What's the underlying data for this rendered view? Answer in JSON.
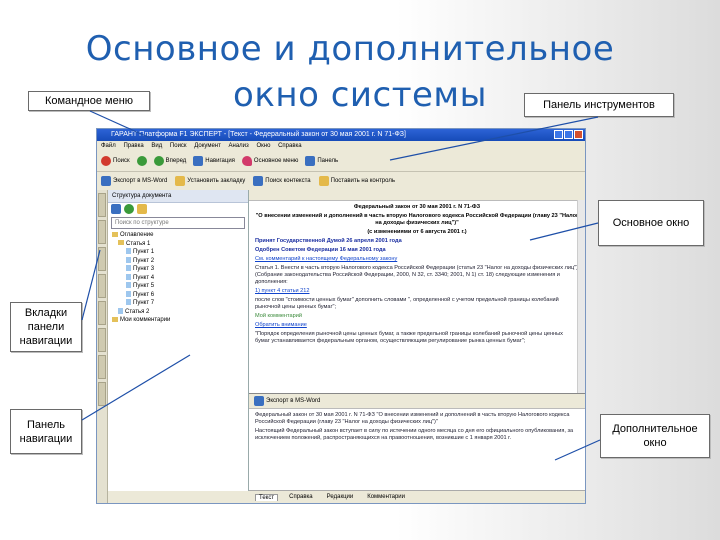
{
  "slide": {
    "title_line1": "Основное и дополнительное",
    "title_line2": "окно системы"
  },
  "callouts": {
    "command_menu": "Командное меню",
    "toolbar_panel": "Панель инструментов",
    "main_window": "Основное окно",
    "nav_tabs": "Вкладки панели навигации",
    "nav_panel": "Панель навигации",
    "additional_window": "Дополнительное окно"
  },
  "app": {
    "window_title": "ГАРАНТ Платформа F1 ЭКСПЕРТ - [Текст - Федеральный закон от 30 мая 2001 г. N 71-ФЗ]",
    "menu": [
      "Файл",
      "Правка",
      "Вид",
      "Поиск",
      "Документ",
      "Анализ",
      "Окно",
      "Справка"
    ],
    "toolbar": {
      "search_btn": "Поиск",
      "forward_btn": "Вперед",
      "nav_btn": "Навигация",
      "cases_btn": "Основное меню",
      "panel_btn": "Панель"
    },
    "toolbar2": {
      "export_btn": "Экспорт в MS-Word",
      "bookmark_btn": "Установить закладку",
      "search_ctx_btn": "Поиск контекста",
      "control_btn": "Поставить на контроль"
    },
    "nav_header": "Структура документа",
    "nav_search": "Поиск по структуре",
    "tree": [
      {
        "label": "Оглавление",
        "kind": "folder",
        "indent": 0
      },
      {
        "label": "Статья 1",
        "kind": "folder",
        "indent": 1
      },
      {
        "label": "Пункт 1",
        "kind": "doc",
        "indent": 2
      },
      {
        "label": "Пункт 2",
        "kind": "doc",
        "indent": 2
      },
      {
        "label": "Пункт 3",
        "kind": "doc",
        "indent": 2
      },
      {
        "label": "Пункт 4",
        "kind": "doc",
        "indent": 2
      },
      {
        "label": "Пункт 5",
        "kind": "doc",
        "indent": 2
      },
      {
        "label": "Пункт 6",
        "kind": "doc",
        "indent": 2
      },
      {
        "label": "Пункт 7",
        "kind": "doc",
        "indent": 2
      },
      {
        "label": "Статья 2",
        "kind": "doc",
        "indent": 1
      },
      {
        "label": "Мои комментарии",
        "kind": "folder",
        "indent": 0
      }
    ],
    "document": {
      "heading": "Федеральный закон от 30 мая 2001 г. N 71-ФЗ",
      "heading2": "\"О внесении изменений и дополнений в часть вторую Налогового кодекса Российской Федерации (главу 23 \"Налог на доходы физических лиц\")\"",
      "changes": "(с изменениями от 6 августа 2001 г.)",
      "accepted": "Принят Государственной Думой 26 апреля 2001 года",
      "approved": "Одобрен Советом Федерации 16 мая 2001 года",
      "comment": "См. комментарий к настоящему Федеральному закону",
      "article": "Статья 1. Внести в часть вторую Налогового кодекса Российской Федерации (статья 23 \"Налог на доходы физических лиц\") (Собрание законодательства Российской Федерации, 2000, N 32, ст. 3340; 2001, N 1) ст. 18) следующие изменения и дополнения:",
      "point1": "1) пункт 4 статьи 212",
      "point1_text": "после слов \"стоимости ценных бумаг\" дополнить словами \", определенной с учетом предельной границы колебаний рыночной цены ценных бумаг\";",
      "mycomment": "Мой комментарий",
      "prev": "Обратить внимание",
      "para": "\"Порядок определения рыночной цены ценных бумаг, а также предельной границы колебаний рыночной цены ценных бумаг устанавливается федеральным органом, осуществляющим регулирование рынка ценных бумаг\";"
    },
    "addwin": {
      "export_btn": "Экспорт в MS-Word",
      "text1": "Федеральный закон от 30 мая 2001 г. N 71-ФЗ \"О внесении изменений и дополнений в часть вторую Налогового кодекса Российской Федерации (главу 23 \"Налог на доходы физических лиц\")\"",
      "text2": "Настоящий Федеральный закон вступает в силу по истечении одного месяца со дня его официального опубликования, за исключением положений, распространяющихся на правоотношения, возникшие с 1 января 2001 г."
    },
    "bottom_tabs": [
      "Текст",
      "Справка",
      "Редакции",
      "Комментарии"
    ]
  }
}
